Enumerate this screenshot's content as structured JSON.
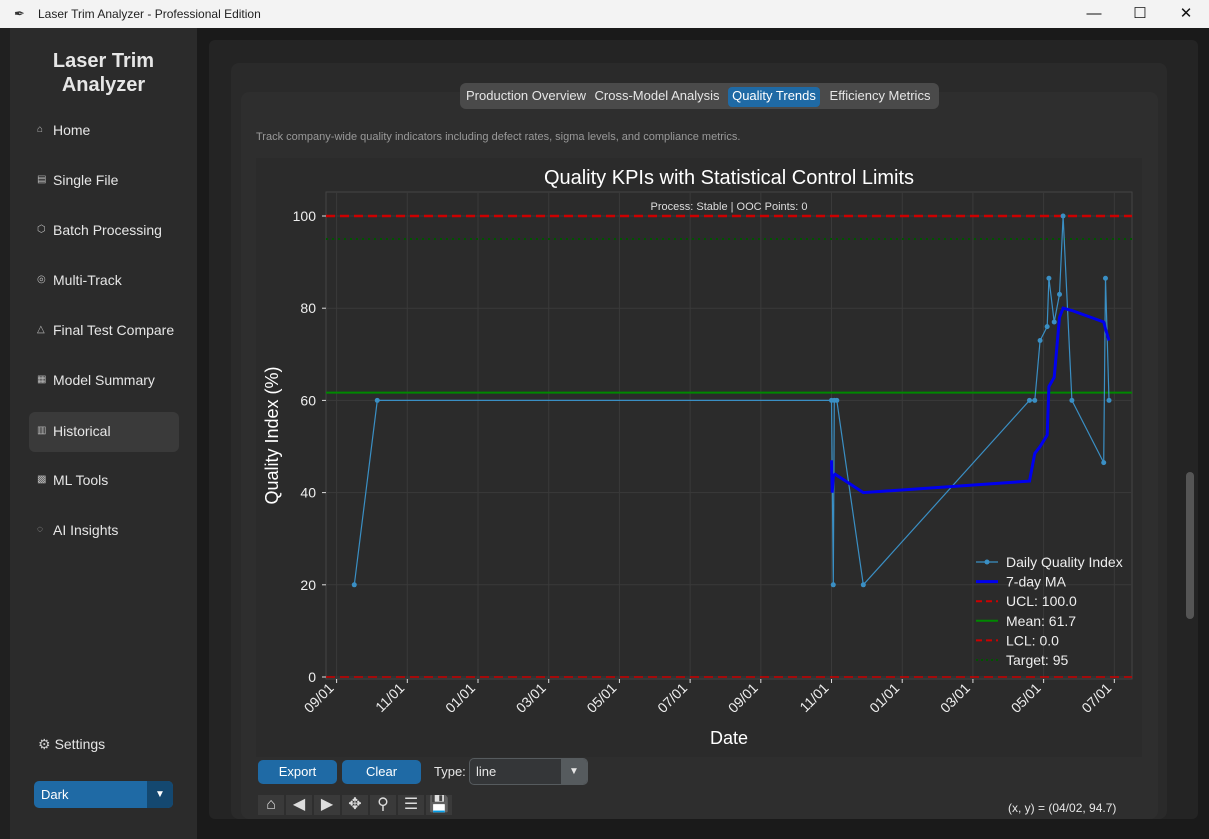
{
  "window": {
    "title": "Laser Trim Analyzer - Professional Edition",
    "app_icon": "feather-icon",
    "minimize": "—",
    "maximize": "☐",
    "close": "✕"
  },
  "sidebar": {
    "brand_line1": "Laser Trim",
    "brand_line2": "Analyzer",
    "items": [
      {
        "label": "Home",
        "icon": "⌂"
      },
      {
        "label": "Single File",
        "icon": "▤"
      },
      {
        "label": "Batch Processing",
        "icon": "⬡"
      },
      {
        "label": "Multi-Track",
        "icon": "◎"
      },
      {
        "label": "Final Test Compare",
        "icon": "△"
      },
      {
        "label": "Model Summary",
        "icon": "▦"
      },
      {
        "label": "Historical",
        "icon": "▥"
      },
      {
        "label": "ML Tools",
        "icon": "▩"
      },
      {
        "label": "AI Insights",
        "icon": "◌"
      }
    ],
    "active_item": "Historical",
    "settings_label": "Settings",
    "theme_value": "Dark"
  },
  "tabs": [
    "Production Overview",
    "Cross-Model Analysis",
    "Quality Trends",
    "Efficiency Metrics"
  ],
  "active_tab": "Quality Trends",
  "description": "Track company-wide quality indicators including defect rates, sigma levels, and compliance metrics.",
  "chart_data": {
    "type": "line",
    "title": "Quality KPIs with Statistical Control Limits",
    "annotation": "Process: Stable | OOC Points: 0",
    "xlabel": "Date",
    "ylabel": "Quality Index (%)",
    "x_ticks": [
      "09/01",
      "11/01",
      "01/01",
      "03/01",
      "05/01",
      "07/01",
      "09/01",
      "11/01",
      "01/01",
      "03/01",
      "05/01",
      "07/01"
    ],
    "y_ticks": [
      0,
      20,
      40,
      60,
      80,
      100
    ],
    "ylim": [
      0,
      100
    ],
    "xlim_months": [
      -0.3,
      22.5
    ],
    "series": [
      {
        "name": "Daily Quality Index",
        "color": "#3a8fc4",
        "x": [
          0.5,
          1.15,
          14.0,
          14.05,
          14.08,
          14.15,
          14.9,
          19.6,
          19.75,
          19.9,
          20.1,
          20.15,
          20.3,
          20.45,
          20.55,
          20.8,
          21.7,
          21.75,
          21.85
        ],
        "values": [
          20,
          60,
          60,
          20,
          60,
          60,
          20,
          60,
          60,
          73,
          76,
          86.5,
          77,
          83,
          100,
          60,
          46.5,
          86.5,
          60
        ]
      },
      {
        "name": "7-day MA",
        "color": "#0000ee",
        "x": [
          14.0,
          14.02,
          14.05,
          14.1,
          14.3,
          14.9,
          19.6,
          19.75,
          19.9,
          20.1,
          20.15,
          20.3,
          20.45,
          20.55,
          20.8,
          21.7,
          21.75,
          21.85
        ],
        "values": [
          47,
          40,
          43.5,
          44,
          43,
          40,
          42.5,
          48.5,
          50,
          52.5,
          63,
          65,
          78,
          80,
          79.5,
          77,
          75.5,
          73
        ]
      }
    ],
    "ucl": {
      "label": "UCL: 100.0",
      "value": 100.0,
      "color": "#cc0000"
    },
    "mean": {
      "label": "Mean: 61.7",
      "value": 61.7,
      "color": "#008800"
    },
    "lcl": {
      "label": "LCL: 0.0",
      "value": 0.0,
      "color": "#cc0000"
    },
    "target": {
      "label": "Target: 95",
      "value": 95,
      "color": "#005500"
    },
    "legend": "lower-right",
    "grid": true
  },
  "controls": {
    "export_label": "Export",
    "clear_label": "Clear",
    "type_label": "Type:",
    "type_value": "line"
  },
  "toolbar_icons": [
    "home-icon",
    "back-icon",
    "forward-icon",
    "pan-icon",
    "zoom-icon",
    "configure-icon",
    "save-icon"
  ],
  "toolbar_glyphs": [
    "⌂",
    "◀",
    "▶",
    "✥",
    "⚲",
    "☰",
    "💾"
  ],
  "coords_readout": "(x, y) = (04/02, 94.7)"
}
